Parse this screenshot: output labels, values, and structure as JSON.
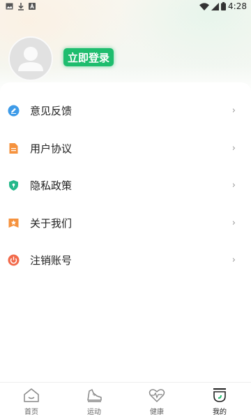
{
  "status_bar": {
    "time": "4:28",
    "icons": [
      "image-icon",
      "download-icon",
      "a-app-icon",
      "wifi-icon",
      "signal-icon",
      "battery-icon"
    ]
  },
  "profile": {
    "login_label": "立即登录"
  },
  "menu": {
    "items": [
      {
        "label": "意见反馈",
        "icon": "feedback-icon",
        "color": "#3e9be8"
      },
      {
        "label": "用户协议",
        "icon": "document-icon",
        "color": "#f5923e"
      },
      {
        "label": "隐私政策",
        "icon": "shield-icon",
        "color": "#25b88a"
      },
      {
        "label": "关于我们",
        "icon": "star-badge-icon",
        "color": "#f5923e"
      },
      {
        "label": "注销账号",
        "icon": "power-icon",
        "color": "#f26a4b"
      }
    ],
    "chevron": "›"
  },
  "tabs": [
    {
      "label": "首页",
      "icon": "home-icon"
    },
    {
      "label": "运动",
      "icon": "shoe-icon"
    },
    {
      "label": "健康",
      "icon": "heart-pulse-icon"
    },
    {
      "label": "我的",
      "icon": "profile-icon",
      "active": true
    }
  ],
  "colors": {
    "accent": "#1ebd6e"
  }
}
